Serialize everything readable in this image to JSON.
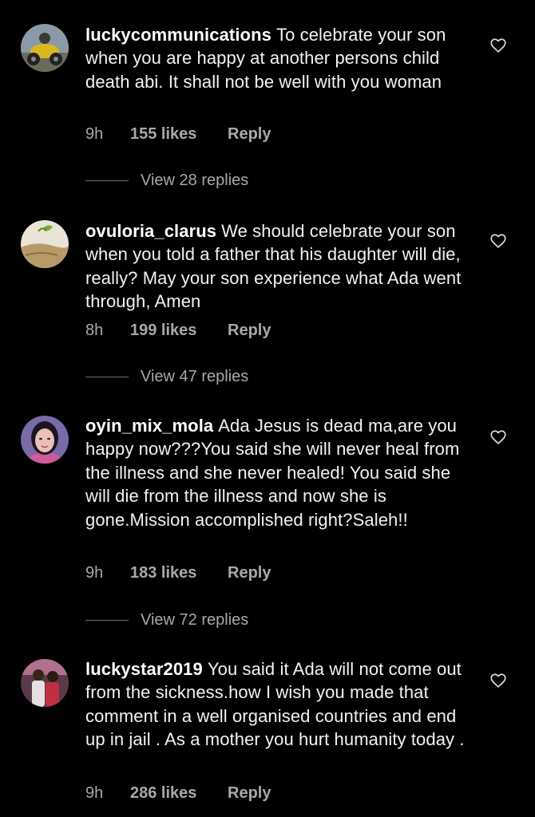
{
  "comments": [
    {
      "username": "luckycommunications",
      "text": "To celebrate your son when you are happy at another persons child death abi. It shall not be well with you woman",
      "time": "9h",
      "likes": "155 likes",
      "reply": "Reply",
      "view_replies": "View 28 replies",
      "avatar_icon": "avatar-photo-motorbike"
    },
    {
      "username": "ovuloria_clarus",
      "text": "We should celebrate your son when you told a father that his daughter will die, really? May your son experience what Ada went through, Amen",
      "time": "8h",
      "likes": "199 likes",
      "reply": "Reply",
      "view_replies": "View 47 replies",
      "avatar_icon": "avatar-photo-sand"
    },
    {
      "username": "oyin_mix_mola",
      "text": "Ada Jesus is dead ma,are you happy now???You said she will never heal from the illness and she never healed! You said she will die from the illness and now she is gone.Mission accomplished right?Saleh!!",
      "time": "9h",
      "likes": "183 likes",
      "reply": "Reply",
      "view_replies": "View 72 replies",
      "avatar_icon": "avatar-photo-woman"
    },
    {
      "username": "luckystar2019",
      "text": "You said it Ada will not come out from the sickness.how I wish you made that comment in a well organised countries and end up in jail . As a mother you hurt humanity today .",
      "time": "9h",
      "likes": "286 likes",
      "reply": "Reply",
      "avatar_icon": "avatar-photo-couple"
    }
  ],
  "colors": {
    "background": "#000000",
    "text": "#f2f2f2",
    "secondary": "#a8a8a8"
  },
  "icons": {
    "like": "heart-outline-icon"
  }
}
